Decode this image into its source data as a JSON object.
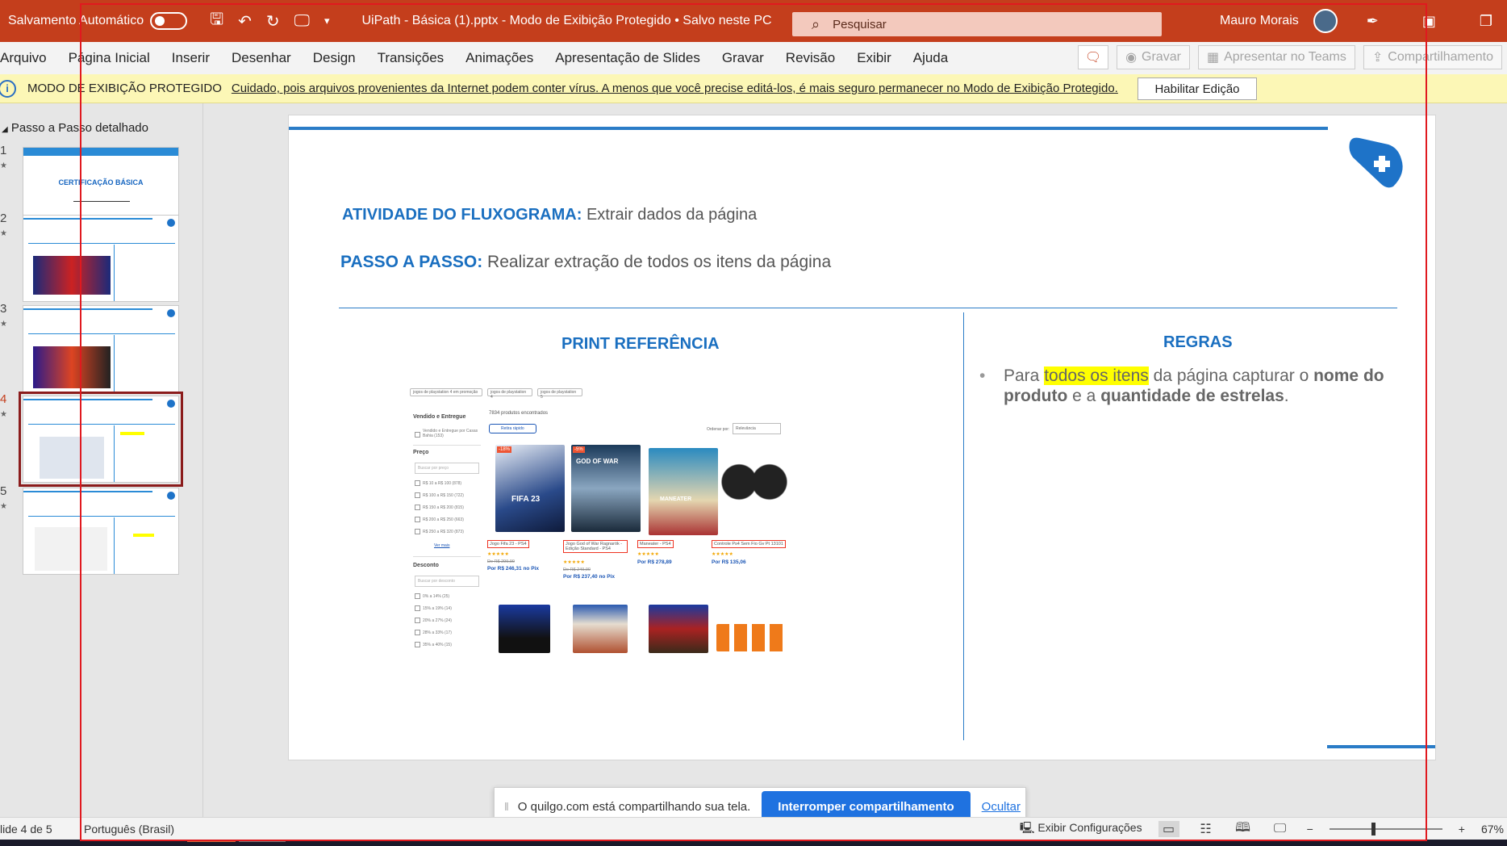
{
  "titlebar": {
    "autosave_label": "Salvamento Automático",
    "doc_title": "UiPath - Básica (1).pptx  -  Modo de Exibição Protegido  •  Salvo neste PC",
    "search_placeholder": "Pesquisar",
    "user_name": "Mauro Morais"
  },
  "menu": {
    "items": [
      "Arquivo",
      "Página Inicial",
      "Inserir",
      "Desenhar",
      "Design",
      "Transições",
      "Animações",
      "Apresentação de Slides",
      "Gravar",
      "Revisão",
      "Exibir",
      "Ajuda"
    ],
    "record": "Gravar",
    "teams": "Apresentar no Teams",
    "share": "Compartilhamento"
  },
  "protected": {
    "title": "MODO DE EXIBIÇÃO PROTEGIDO",
    "message": "Cuidado, pois arquivos provenientes da Internet podem conter vírus. A menos que você precise editá-los, é mais seguro permanecer no Modo de  Exibição Protegido.",
    "button": "Habilitar Edição"
  },
  "thumbs": {
    "section": "Passo a Passo detalhado",
    "numbers": [
      "1",
      "2",
      "3",
      "4",
      "5"
    ],
    "slide1_title": "CERTIFICAÇÃO BÁSICA"
  },
  "slide": {
    "line1_key": "ATIVIDADE DO FLUXOGRAMA:",
    "line1_val": "Extrair dados da página",
    "line2_key": "PASSO A PASSO:",
    "line2_val": "Realizar extração de todos os itens da página",
    "left_head": "PRINT REFERÊNCIA",
    "right_head": "REGRAS",
    "rule_pre": "Para ",
    "rule_hl": "todos os itens",
    "rule_mid": " da página capturar o ",
    "rule_b1": "nome do produto",
    "rule_mid2": " e a ",
    "rule_b2": "quantidade de estrelas",
    "rule_end": "."
  },
  "print": {
    "chips": [
      "jogos de playstation 4 em promoção",
      "jogos de playstation 4",
      "jogos de playstation 5"
    ],
    "count": "7834 produtos encontrados",
    "quick": "Retira rápido",
    "sort_label": "Ordenar por:",
    "sort_value": "Relevância",
    "f_sold": "Vendido e Entregue",
    "f_sold_opt": "Vendido e Entregue por Casas Bahia (153)",
    "f_price": "Preço",
    "f_price_ph": "Buscar por preço",
    "price_opts": [
      "R$ 10 a R$ 100 (878)",
      "R$ 100 a R$ 150 (722)",
      "R$ 150 a R$ 200 (815)",
      "R$ 200 a R$ 250 (663)",
      "R$ 250 a R$ 320 (873)"
    ],
    "see_more": "Ver mais",
    "f_disc": "Desconto",
    "f_disc_ph": "Buscar por desconto",
    "disc_opts": [
      "0% a 14% (25)",
      "15% a 19% (14)",
      "20% a 27% (24)",
      "28% a 33% (17)",
      "35% a 40% (15)"
    ],
    "products": [
      {
        "name": "Jogo Fifa 23 - PS4",
        "old": "De R$ 299,90",
        "price": "Por R$ 246,31 no Pix",
        "badge": "-18%",
        "cover": "FIFA 23"
      },
      {
        "name": "Jogo God of War Ragnarök - Edição Standard - PS4",
        "old": "De R$ 249,90",
        "price": "Por R$ 237,40 no Pix",
        "badge": "-5%",
        "cover": "GOD OF WAR"
      },
      {
        "name": "Maneater - PS4",
        "old": "",
        "price": "Por R$ 278,89",
        "badge": "",
        "cover": "MANEATER"
      },
      {
        "name": "Controle Ps4 Sem Fio Gv Pt 13101",
        "old": "",
        "price": "Por R$ 135,06",
        "badge": "",
        "cover": ""
      }
    ],
    "stars": "★★★★★"
  },
  "share": {
    "message": "O quilgo.com está compartilhando sua tela.",
    "stop": "Interromper compartilhamento",
    "hide": "Ocultar"
  },
  "status": {
    "slide": "lide 4 de 5",
    "lang": "Português (Brasil)",
    "config": "Exibir Configurações",
    "zoom": "67%"
  },
  "colors": {
    "titlebar": "#c43e1c",
    "accent_blue": "#1a6fc0",
    "protected_bg": "#fcf7b6",
    "frame": "#e0191f"
  }
}
